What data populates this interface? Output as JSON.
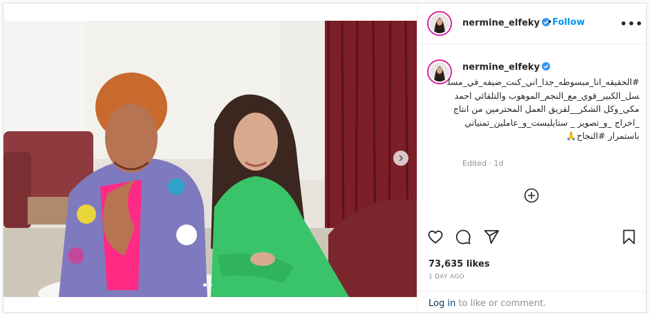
{
  "post": {
    "username": "nermine_elfeky",
    "follow_label": "Follow",
    "more_label": "•••",
    "bullet": "•",
    "caption": "#الحقيقه_انا_مبسوطه_جدا_اني_كنت_ضيفه_في_مسلسل_الكبير_قوي_مع_النجم_الموهوب والتلقائي احمد مكي_وكل الشكر__لفريق العمل المحترمين من انتاج _اخراج _و_تصوير _ ستايليست_و_عاملين_تمنياتي باستمرار #النجاح🙏",
    "edited": "Edited · 1d",
    "likes": "73,635 likes",
    "date": "1 DAY AGO",
    "login_link": "Log in",
    "login_rest": " to like or comment."
  },
  "carousel": {
    "current": 1,
    "total": 2
  },
  "icons": {
    "verified": "verified-badge-icon",
    "heart": "heart-icon",
    "comment": "comment-icon",
    "share": "share-icon",
    "save": "bookmark-icon",
    "add": "add-comment-icon",
    "next": "chevron-right-icon"
  },
  "colors": {
    "link": "#0095f6",
    "verified": "#3897f0",
    "avatar_ring": "#d6249f"
  }
}
